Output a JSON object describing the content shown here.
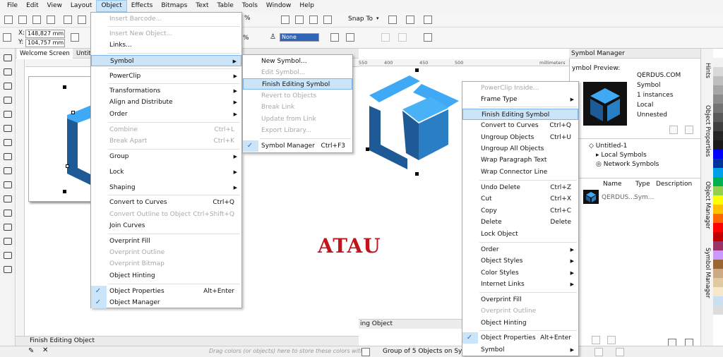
{
  "menubar": [
    "File",
    "Edit",
    "View",
    "Layout",
    "Object",
    "Effects",
    "Bitmaps",
    "Text",
    "Table",
    "Tools",
    "Window",
    "Help"
  ],
  "toolbar": {
    "x_field": "148,827 mm",
    "y_field": "104,757 mm",
    "x_label": "X:",
    "y_label": "Y:",
    "snap_label": "Snap To",
    "percent": "%",
    "outline": "None"
  },
  "tabs": {
    "welcome": "Welcome Screen",
    "untitled": "Untitl",
    "right_tab": "ing Object"
  },
  "ruler": {
    "r1": "550",
    "r2": "400",
    "r3": "450",
    "r4": "500",
    "unit": "millimeters"
  },
  "status": {
    "left": "Finish Editing Object",
    "right": "Group of 5 Objects on Symb",
    "drag_hint": "Drag colors (or objects) here to store these colors with"
  },
  "object_menu": {
    "items": [
      {
        "label": "Insert Barcode...",
        "dis": true
      },
      {
        "label": "Insert New Object...",
        "dis": true
      },
      {
        "label": "Links..."
      },
      {
        "label": "Symbol",
        "hl": true
      },
      {
        "label": "PowerClip"
      },
      {
        "label": "Transformations"
      },
      {
        "label": "Align and Distribute"
      },
      {
        "label": "Order"
      },
      {
        "label": "Combine",
        "sc": "Ctrl+L",
        "dis": true
      },
      {
        "label": "Break Apart",
        "sc": "Ctrl+K",
        "dis": true
      },
      {
        "label": "Group"
      },
      {
        "label": "Lock"
      },
      {
        "label": "Shaping"
      },
      {
        "label": "Convert to Curves",
        "sc": "Ctrl+Q"
      },
      {
        "label": "Convert Outline to Object",
        "sc": "Ctrl+Shift+Q",
        "dis": true
      },
      {
        "label": "Join Curves"
      },
      {
        "label": "Overprint Fill"
      },
      {
        "label": "Overprint Outline",
        "dis": true
      },
      {
        "label": "Overprint Bitmap",
        "dis": true
      },
      {
        "label": "Object Hinting"
      },
      {
        "label": "Object Properties",
        "sc": "Alt+Enter",
        "chk": true
      },
      {
        "label": "Object Manager",
        "chk": true
      }
    ]
  },
  "symbol_menu": {
    "items": [
      {
        "label": "New Symbol..."
      },
      {
        "label": "Edit Symbol...",
        "dis": true
      },
      {
        "label": "Finish Editing Symbol",
        "hl": true
      },
      {
        "label": "Revert to Objects",
        "dis": true
      },
      {
        "label": "Break Link",
        "dis": true
      },
      {
        "label": "Update from Link",
        "dis": true
      },
      {
        "label": "Export Library...",
        "dis": true
      },
      {
        "label": "Symbol Manager",
        "sc": "Ctrl+F3",
        "chk": true
      }
    ]
  },
  "context_menu": {
    "items": [
      {
        "label": "PowerClip Inside...",
        "dis": true
      },
      {
        "label": "Frame Type"
      },
      {
        "label": "Finish Editing Symbol",
        "hl": true
      },
      {
        "label": "Convert to Curves",
        "sc": "Ctrl+Q"
      },
      {
        "label": "Ungroup Objects",
        "sc": "Ctrl+U"
      },
      {
        "label": "Ungroup All Objects"
      },
      {
        "label": "Wrap Paragraph Text"
      },
      {
        "label": "Wrap Connector Line"
      },
      {
        "label": "Undo Delete",
        "sc": "Ctrl+Z"
      },
      {
        "label": "Cut",
        "sc": "Ctrl+X"
      },
      {
        "label": "Copy",
        "sc": "Ctrl+C"
      },
      {
        "label": "Delete",
        "sc": "Delete"
      },
      {
        "label": "Lock Object"
      },
      {
        "label": "Order"
      },
      {
        "label": "Object Styles"
      },
      {
        "label": "Color Styles"
      },
      {
        "label": "Internet Links"
      },
      {
        "label": "Overprint Fill"
      },
      {
        "label": "Overprint Outline",
        "dis": true
      },
      {
        "label": "Object Hinting"
      },
      {
        "label": "Object Properties",
        "sc": "Alt+Enter",
        "chk": true
      },
      {
        "label": "Symbol"
      }
    ]
  },
  "center_text": "ATAU",
  "docker": {
    "title": "Symbol Manager",
    "preview": "ymbol Preview:",
    "name": "QERDUS.COM",
    "type": "Symbol",
    "instances": "1 instances",
    "scope": "Local",
    "state": "Unnested",
    "tree": [
      "Untitled-1",
      "Local Symbols",
      "Network Symbols"
    ],
    "cols": [
      "Name",
      "Type",
      "Description"
    ],
    "row": {
      "name": "QERDUS....",
      "type": "Sym..."
    }
  },
  "sidetabs": [
    "Hints",
    "Object Properties",
    "Object Manager",
    "Symbol Manager"
  ],
  "palette": [
    "#ffffff",
    "#f2f2f2",
    "#d9d9d9",
    "#bfbfbf",
    "#a6a6a6",
    "#8c8c8c",
    "#737373",
    "#595959",
    "#404040",
    "#262626",
    "#1a1a1a",
    "#0000ff",
    "#003399",
    "#00a0e9",
    "#00b050",
    "#92d050",
    "#ffff00",
    "#ffc000",
    "#ff6600",
    "#ff0000",
    "#c00000",
    "#993366",
    "#cc99ff",
    "#996633",
    "#ccaa88",
    "#e0c8a0",
    "#f5e6cc",
    "#c8e0f0",
    "#dcdcdc",
    "#ffffff"
  ],
  "colors": {
    "logo_light": "#3fa9f5",
    "logo_mid": "#2a7fc4",
    "logo_dark": "#1d5a96",
    "accent_red": "#c0151c"
  }
}
